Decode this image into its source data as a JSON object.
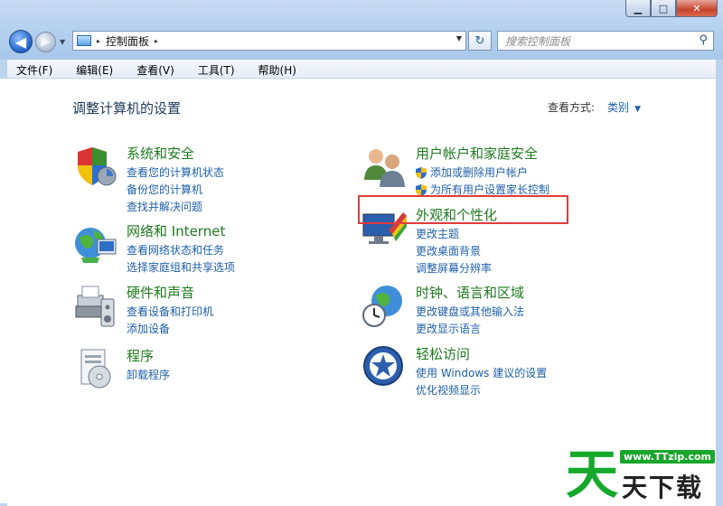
{
  "window": {
    "minimize": "▁",
    "maximize": "□",
    "close": "✕"
  },
  "nav": {
    "back_icon": "arrow-left-icon",
    "forward_icon": "arrow-right-icon",
    "refresh_symbol": "↻"
  },
  "address": {
    "path": "控制面板",
    "separator": "▸"
  },
  "search": {
    "placeholder": "搜索控制面板"
  },
  "menu": [
    "文件(F)",
    "编辑(E)",
    "查看(V)",
    "工具(T)",
    "帮助(H)"
  ],
  "page": {
    "title": "调整计算机的设置",
    "view_by_label": "查看方式:",
    "view_by_value": "类别"
  },
  "categories": [
    {
      "title": "系统和安全",
      "links": [
        "查看您的计算机状态",
        "备份您的计算机",
        "查找并解决问题"
      ]
    },
    {
      "title": "网络和 Internet",
      "links": [
        "查看网络状态和任务",
        "选择家庭组和共享选项"
      ]
    },
    {
      "title": "硬件和声音",
      "links": [
        "查看设备和打印机",
        "添加设备"
      ]
    },
    {
      "title": "程序",
      "links": [
        "卸载程序"
      ]
    },
    {
      "title": "用户帐户和家庭安全",
      "links": [
        "添加或删除用户帐户",
        "为所有用户设置家长控制"
      ]
    },
    {
      "title": "外观和个性化",
      "links": [
        "更改主题",
        "更改桌面背景",
        "调整屏幕分辨率"
      ]
    },
    {
      "title": "时钟、语言和区域",
      "links": [
        "更改键盘或其他输入法",
        "更改显示语言"
      ]
    },
    {
      "title": "轻松访问",
      "links": [
        "使用 Windows 建议的设置",
        "优化视频显示"
      ]
    }
  ],
  "watermark": {
    "big": "天",
    "url": "www.TTzip.com",
    "small": "天下载"
  },
  "colors": {
    "category_title": "#1e7a1e",
    "link": "#1e5fa8",
    "highlight": "#e23b3b",
    "watermark": "#15a92c"
  }
}
